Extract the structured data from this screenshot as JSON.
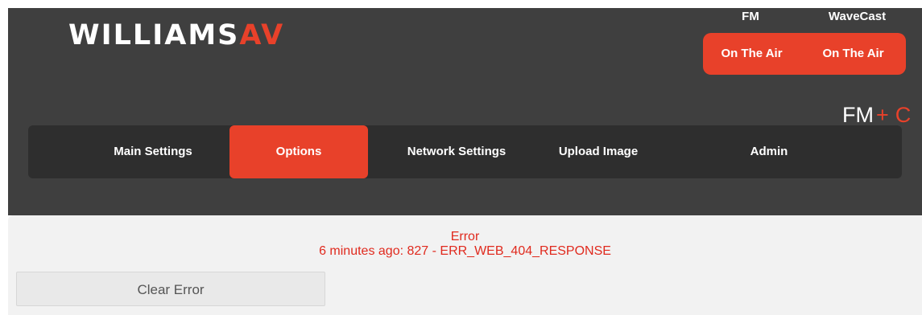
{
  "header": {
    "logo": {
      "text_main": "WILLIAMS",
      "text_accent": "AV",
      "colors": {
        "main": "#ffffff",
        "accent": "#e8412a"
      }
    },
    "status": {
      "fm_label": "FM",
      "wavecast_label": "WaveCast",
      "fm_status": "On The Air",
      "wavecast_status": "On The Air",
      "pill_color": "#e8412a"
    },
    "model": {
      "base": "FM",
      "plus": "+",
      "suffix": "C"
    },
    "background_color": "#3f3f3f"
  },
  "nav": {
    "items": [
      {
        "label": "Main Settings"
      },
      {
        "label": "Options",
        "active": true
      },
      {
        "label": "Network Settings"
      },
      {
        "label": "Upload Image"
      },
      {
        "label": "Admin"
      }
    ],
    "active_color": "#e8412a",
    "bar_color": "#2e2e2e"
  },
  "content": {
    "error_title": "Error",
    "error_message": "6 minutes ago: 827 - ERR_WEB_404_RESPONSE",
    "error_color": "#e02a1e",
    "clear_button_label": "Clear Error"
  }
}
